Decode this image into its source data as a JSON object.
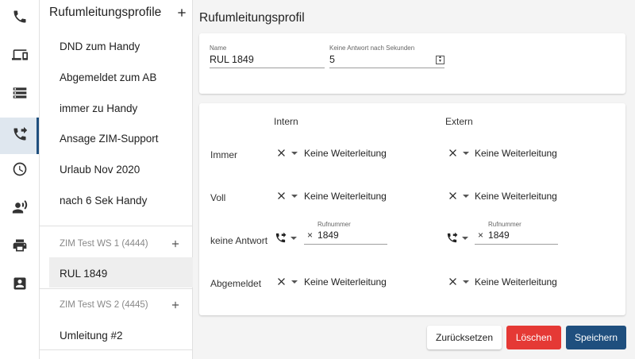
{
  "list": {
    "title": "Rufumleitungsprofile",
    "items": [
      "DND zum Handy",
      "Abgemeldet zum AB",
      "immer zu Handy",
      "Ansage ZIM-Support",
      "Urlaub Nov 2020",
      "nach 6 Sek Handy"
    ],
    "groups": [
      {
        "label": "ZIM Test WS 1 (4444)",
        "items": [
          "RUL 1849"
        ]
      },
      {
        "label": "ZIM Test WS 2 (4445)",
        "items": [
          "Umleitung #2"
        ]
      }
    ],
    "selected": "RUL 1849"
  },
  "main": {
    "title": "Rufumleitungsprofil",
    "name_label": "Name",
    "name_value": "RUL 1849",
    "timeout_label": "Keine Antwort nach Sekunden",
    "timeout_value": "5",
    "col_intern": "Intern",
    "col_extern": "Extern",
    "rows": [
      {
        "label": "Immer",
        "intern": "Keine Weiterleitung",
        "extern": "Keine Weiterleitung"
      },
      {
        "label": "Voll",
        "intern": "Keine Weiterleitung",
        "extern": "Keine Weiterleitung"
      },
      {
        "label": "keine Antwort",
        "intern_label": "Rufnummer",
        "intern_number": "1849",
        "extern_label": "Rufnummer",
        "extern_number": "1849"
      },
      {
        "label": "Abgemeldet",
        "intern": "Keine Weiterleitung",
        "extern": "Keine Weiterleitung"
      }
    ]
  },
  "buttons": {
    "reset": "Zurücksetzen",
    "delete": "Löschen",
    "save": "Speichern"
  },
  "icons": [
    "phone-icon",
    "devices-icon",
    "storage-icon",
    "phone-forward-icon",
    "clock-icon",
    "voice-icon",
    "printer-icon",
    "contact-icon"
  ],
  "colors": {
    "accent": "#1f4f7e",
    "danger": "#e53935",
    "active_bg": "#dfe7ef"
  }
}
